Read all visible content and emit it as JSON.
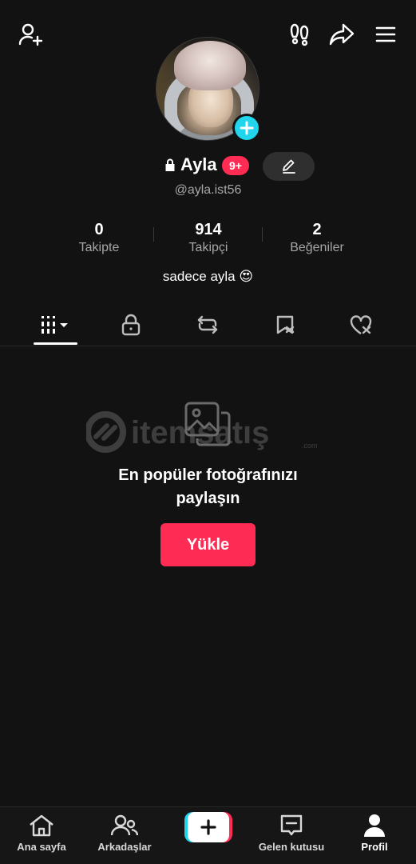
{
  "top_bar": {
    "icons": [
      "add-friend-icon",
      "footprints-icon",
      "share-icon",
      "menu-icon"
    ]
  },
  "profile": {
    "display_name": "Ayla",
    "notification_badge": "9+",
    "username": "@ayla.ist56",
    "bio": "sadece ayla 😍",
    "private": true
  },
  "stats": [
    {
      "value": "0",
      "label": "Takipte"
    },
    {
      "value": "914",
      "label": "Takipçi"
    },
    {
      "value": "2",
      "label": "Beğeniler"
    }
  ],
  "tabs": [
    {
      "icon": "videos-grid-icon",
      "active": true
    },
    {
      "icon": "lock-icon",
      "active": false
    },
    {
      "icon": "repost-icon",
      "active": false
    },
    {
      "icon": "favorites-icon",
      "active": false
    },
    {
      "icon": "liked-icon",
      "active": false
    }
  ],
  "empty_state": {
    "line1": "En popüler fotoğrafınızı",
    "line2": "paylaşın",
    "button": "Yükle"
  },
  "bottom_nav": [
    {
      "label": "Ana sayfa",
      "icon": "home-icon"
    },
    {
      "label": "Arkadaşlar",
      "icon": "friends-icon"
    },
    {
      "label": "",
      "icon": "create-plus-icon"
    },
    {
      "label": "Gelen kutusu",
      "icon": "inbox-icon"
    },
    {
      "label": "Profil",
      "icon": "profile-icon",
      "active": true
    }
  ],
  "colors": {
    "background": "#121212",
    "accent_red": "#fe2c55",
    "accent_cyan": "#20d5ec",
    "muted_text": "#a6a6a6"
  }
}
